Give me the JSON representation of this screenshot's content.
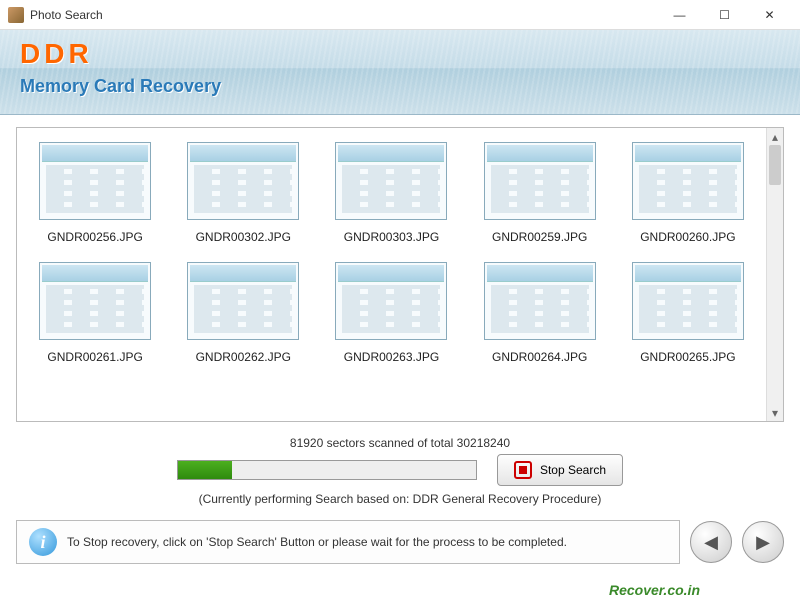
{
  "titlebar": {
    "title": "Photo Search",
    "minimize": "—",
    "maximize": "☐",
    "close": "✕"
  },
  "header": {
    "logo": "DDR",
    "app_name": "Memory Card Recovery"
  },
  "results": {
    "files": [
      {
        "name": "GNDR00256.JPG"
      },
      {
        "name": "GNDR00302.JPG"
      },
      {
        "name": "GNDR00303.JPG"
      },
      {
        "name": "GNDR00259.JPG"
      },
      {
        "name": "GNDR00260.JPG"
      },
      {
        "name": "GNDR00261.JPG"
      },
      {
        "name": "GNDR00262.JPG"
      },
      {
        "name": "GNDR00263.JPG"
      },
      {
        "name": "GNDR00264.JPG"
      },
      {
        "name": "GNDR00265.JPG"
      }
    ]
  },
  "progress": {
    "status_text": "81920 sectors scanned of total 30218240",
    "procedure_text": "(Currently performing Search based on:  DDR General Recovery Procedure)",
    "stop_label": "Stop Search"
  },
  "info": {
    "message": "To Stop recovery, click on 'Stop Search' Button or please wait for the process to be completed."
  },
  "nav": {
    "back": "◀",
    "forward": "▶"
  },
  "watermark": "Recover.co.in"
}
